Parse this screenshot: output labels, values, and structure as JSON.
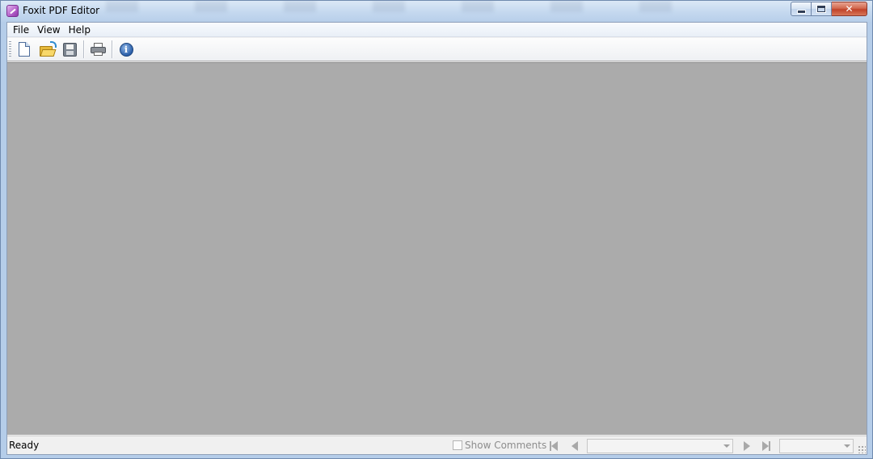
{
  "window": {
    "title": "Foxit PDF Editor"
  },
  "menu": {
    "items": [
      "File",
      "View",
      "Help"
    ]
  },
  "toolbar": {
    "buttons": [
      {
        "icon": "new-document-icon"
      },
      {
        "icon": "open-folder-icon"
      },
      {
        "icon": "save-icon"
      },
      {
        "icon": "print-icon"
      },
      {
        "icon": "info-icon"
      }
    ],
    "info_glyph": "i"
  },
  "status": {
    "text": "Ready",
    "show_comments_label": "Show Comments",
    "show_comments_checked": false,
    "page_field_value": "",
    "zoom_field_value": ""
  },
  "colors": {
    "document_background": "#ababab",
    "close_button": "#c1432a"
  }
}
